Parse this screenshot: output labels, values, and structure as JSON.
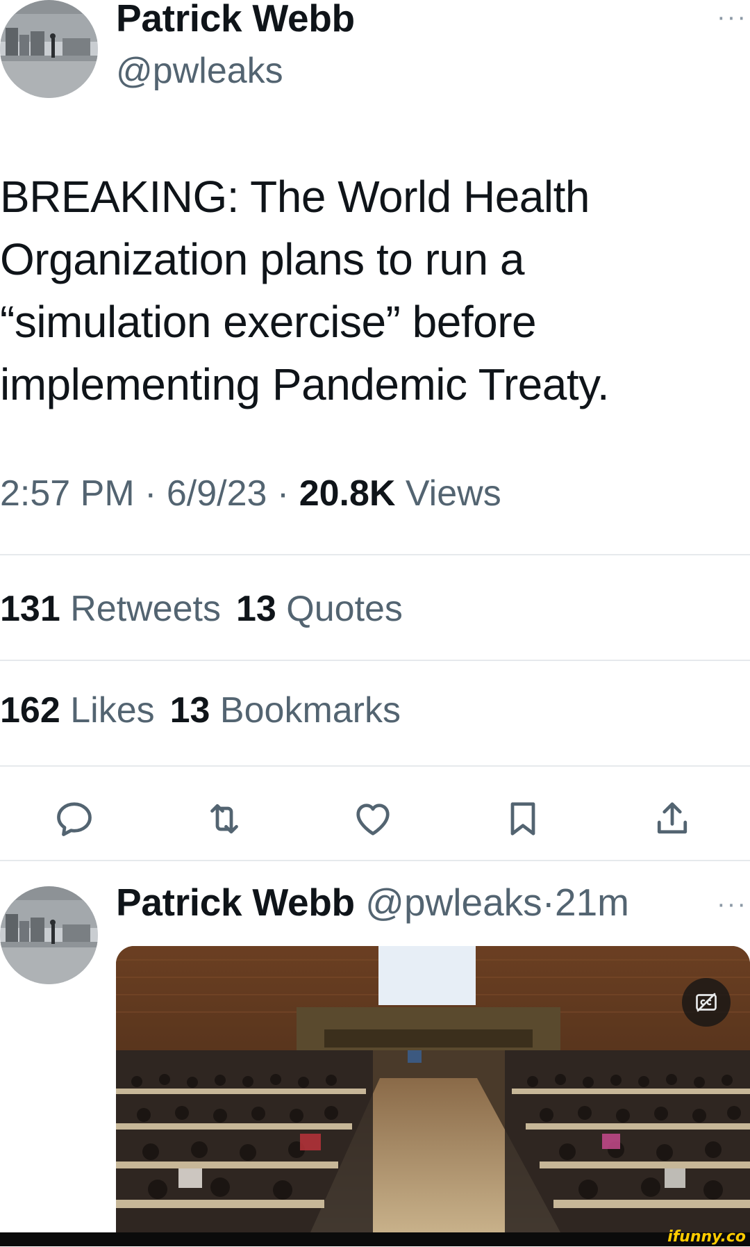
{
  "tweet": {
    "author_name": "Patrick Webb",
    "author_handle": "@pwleaks",
    "more_glyph": "···",
    "text": "BREAKING: The World Health\nOrganization plans to run a\n“simulation exercise” before\nimplementing Pandemic Treaty.",
    "time": "2:57 PM",
    "date": "6/9/23",
    "separator": "·",
    "views_count": "20.8K",
    "views_label": "Views"
  },
  "stats": {
    "retweets_count": "131",
    "retweets_label": "Retweets",
    "quotes_count": "13",
    "quotes_label": "Quotes",
    "likes_count": "162",
    "likes_label": "Likes",
    "bookmarks_count": "13",
    "bookmarks_label": "Bookmarks"
  },
  "actions": {
    "reply_icon": "reply-icon",
    "retweet_icon": "retweet-icon",
    "like_icon": "heart-icon",
    "bookmark_icon": "bookmark-icon",
    "share_icon": "share-icon"
  },
  "reply": {
    "author_name": "Patrick Webb",
    "author_handle": "@pwleaks",
    "separator": "·",
    "time_ago": "21m",
    "more_glyph": "···",
    "media_badge_icon": "closed-captions-icon"
  },
  "watermark": "ifunny.co",
  "colors": {
    "text_primary": "#0f1419",
    "text_secondary": "#536471",
    "divider": "#e6e9ec",
    "watermark": "#ffcc00"
  }
}
